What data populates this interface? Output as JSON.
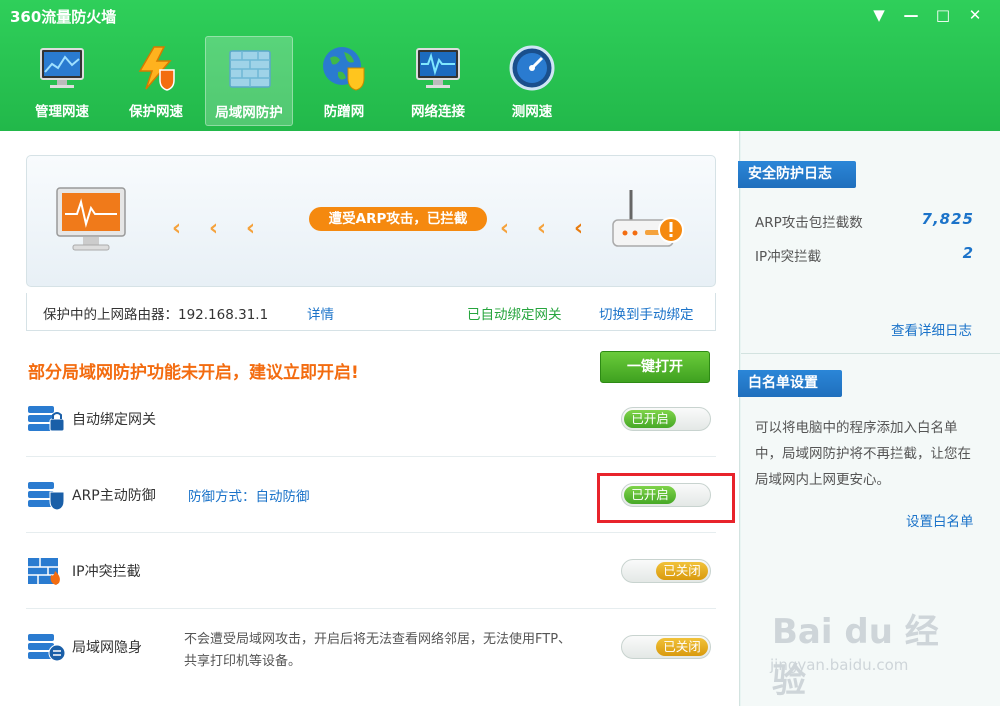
{
  "app": {
    "title": "360流量防火墙"
  },
  "window_controls": {
    "menu": "▼",
    "minimize": "—",
    "maximize": "□",
    "close": "✕"
  },
  "tabs": [
    {
      "label": "管理网速",
      "icon": "monitor-chart-icon",
      "active": false
    },
    {
      "label": "保护网速",
      "icon": "lightning-shield-icon",
      "active": false
    },
    {
      "label": "局域网防护",
      "icon": "firewall-icon",
      "active": true
    },
    {
      "label": "防蹭网",
      "icon": "globe-shield-icon",
      "active": false
    },
    {
      "label": "网络连接",
      "icon": "network-monitor-icon",
      "active": false
    },
    {
      "label": "测网速",
      "icon": "speedometer-icon",
      "active": false
    }
  ],
  "banner": {
    "attack_message": "遭受ARP攻击，已拦截",
    "left_icon": "computer-icon",
    "right_icon": "router-warning-icon"
  },
  "router": {
    "label": "保护中的上网路由器：192.168.31.1",
    "detail_link": "详情",
    "bound_status": "已自动绑定网关",
    "switch_link": "切换到手动绑定"
  },
  "warning": {
    "text": "部分局域网防护功能未开启，建议立即开启!",
    "onekey_button": "一键打开"
  },
  "features": [
    {
      "label": "自动绑定网关",
      "icon": "gateway-lock-icon",
      "state": "已开启",
      "on": true
    },
    {
      "label": "ARP主动防御",
      "icon": "arp-shield-icon",
      "mode": "防御方式：自动防御",
      "state": "已开启",
      "on": true
    },
    {
      "label": "IP冲突拦截",
      "icon": "ip-firewall-icon",
      "state": "已关闭",
      "on": false
    },
    {
      "label": "局域网隐身",
      "icon": "stealth-icon",
      "desc": "不会遭受局域网攻击，开启后将无法查看网络邻居，无法使用FTP、共享打印机等设备。",
      "state": "已关闭",
      "on": false
    }
  ],
  "security_log": {
    "title": "安全防护日志",
    "arp_label": "ARP攻击包拦截数",
    "arp_value": "7,825",
    "ip_label": "IP冲突拦截",
    "ip_value": "2",
    "detail_link": "查看详细日志"
  },
  "whitelist": {
    "title": "白名单设置",
    "desc": "可以将电脑中的程序添加入白名单中，局域网防护将不再拦截，让您在局域网内上网更安心。",
    "link": "设置白名单"
  },
  "watermark": {
    "text": "Bai du 经验",
    "sub": "jingyan.baidu.com"
  },
  "colors": {
    "header_green": "#2fcf5a",
    "accent_orange": "#f5890f",
    "link_blue": "#1b73c9",
    "highlight_red": "#e8232b"
  }
}
